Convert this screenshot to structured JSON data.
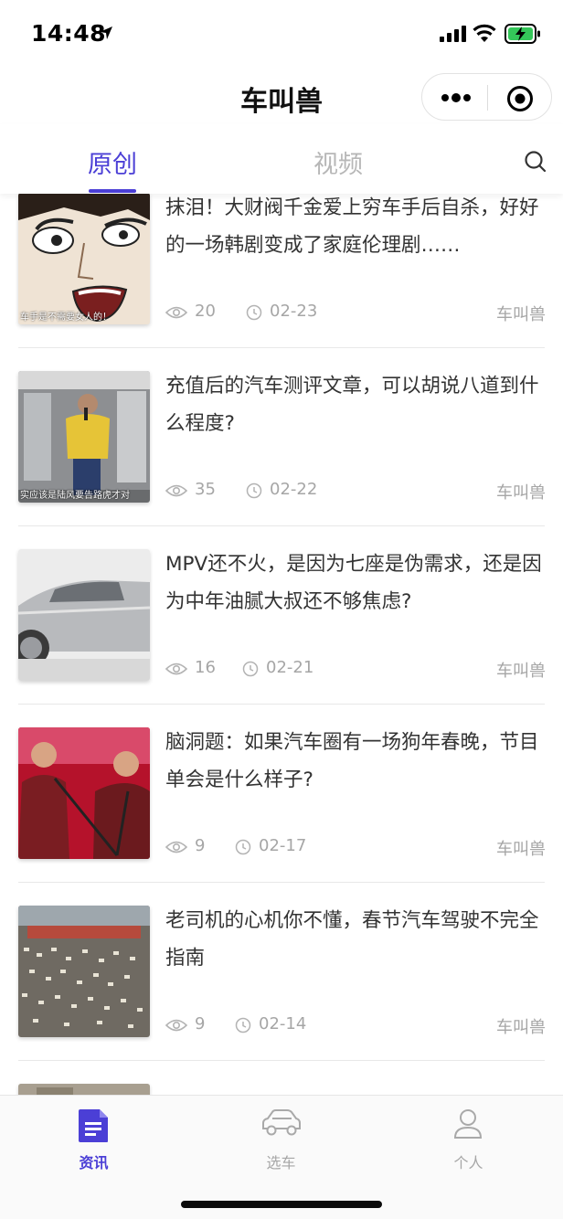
{
  "status": {
    "time": "14:48"
  },
  "nav": {
    "title": "车叫兽"
  },
  "tabs": {
    "active": "原创",
    "inactive": "视频"
  },
  "colors": {
    "accent": "#4b3fd6",
    "muted": "#a6a6a6",
    "battery": "#34c759"
  },
  "articles": [
    {
      "title": "抹泪！大财阀千金爱上穷车手后自杀，好好的一场韩剧变成了家庭伦理剧……",
      "views": "20",
      "date": "02-23",
      "author": "车叫兽",
      "thumb_caption": "车手是不需要女人的！"
    },
    {
      "title": "充值后的汽车测评文章，可以胡说八道到什么程度?",
      "views": "35",
      "date": "02-22",
      "author": "车叫兽",
      "thumb_caption": "实应该是陆风要告路虎才对"
    },
    {
      "title": "MPV还不火，是因为七座是伪需求，还是因为中年油腻大叔还不够焦虑?",
      "views": "16",
      "date": "02-21",
      "author": "车叫兽",
      "thumb_caption": ""
    },
    {
      "title": "脑洞题：如果汽车圈有一场狗年春晚，节目单会是什么样子?",
      "views": "9",
      "date": "02-17",
      "author": "车叫兽",
      "thumb_caption": ""
    },
    {
      "title": "老司机的心机你不懂，春节汽车驾驶不完全指南",
      "views": "9",
      "date": "02-14",
      "author": "车叫兽",
      "thumb_caption": ""
    }
  ],
  "tabbar": {
    "items": [
      {
        "label": "资讯",
        "icon": "document-icon",
        "active": true
      },
      {
        "label": "选车",
        "icon": "car-icon",
        "active": false
      },
      {
        "label": "个人",
        "icon": "person-icon",
        "active": false
      }
    ]
  }
}
